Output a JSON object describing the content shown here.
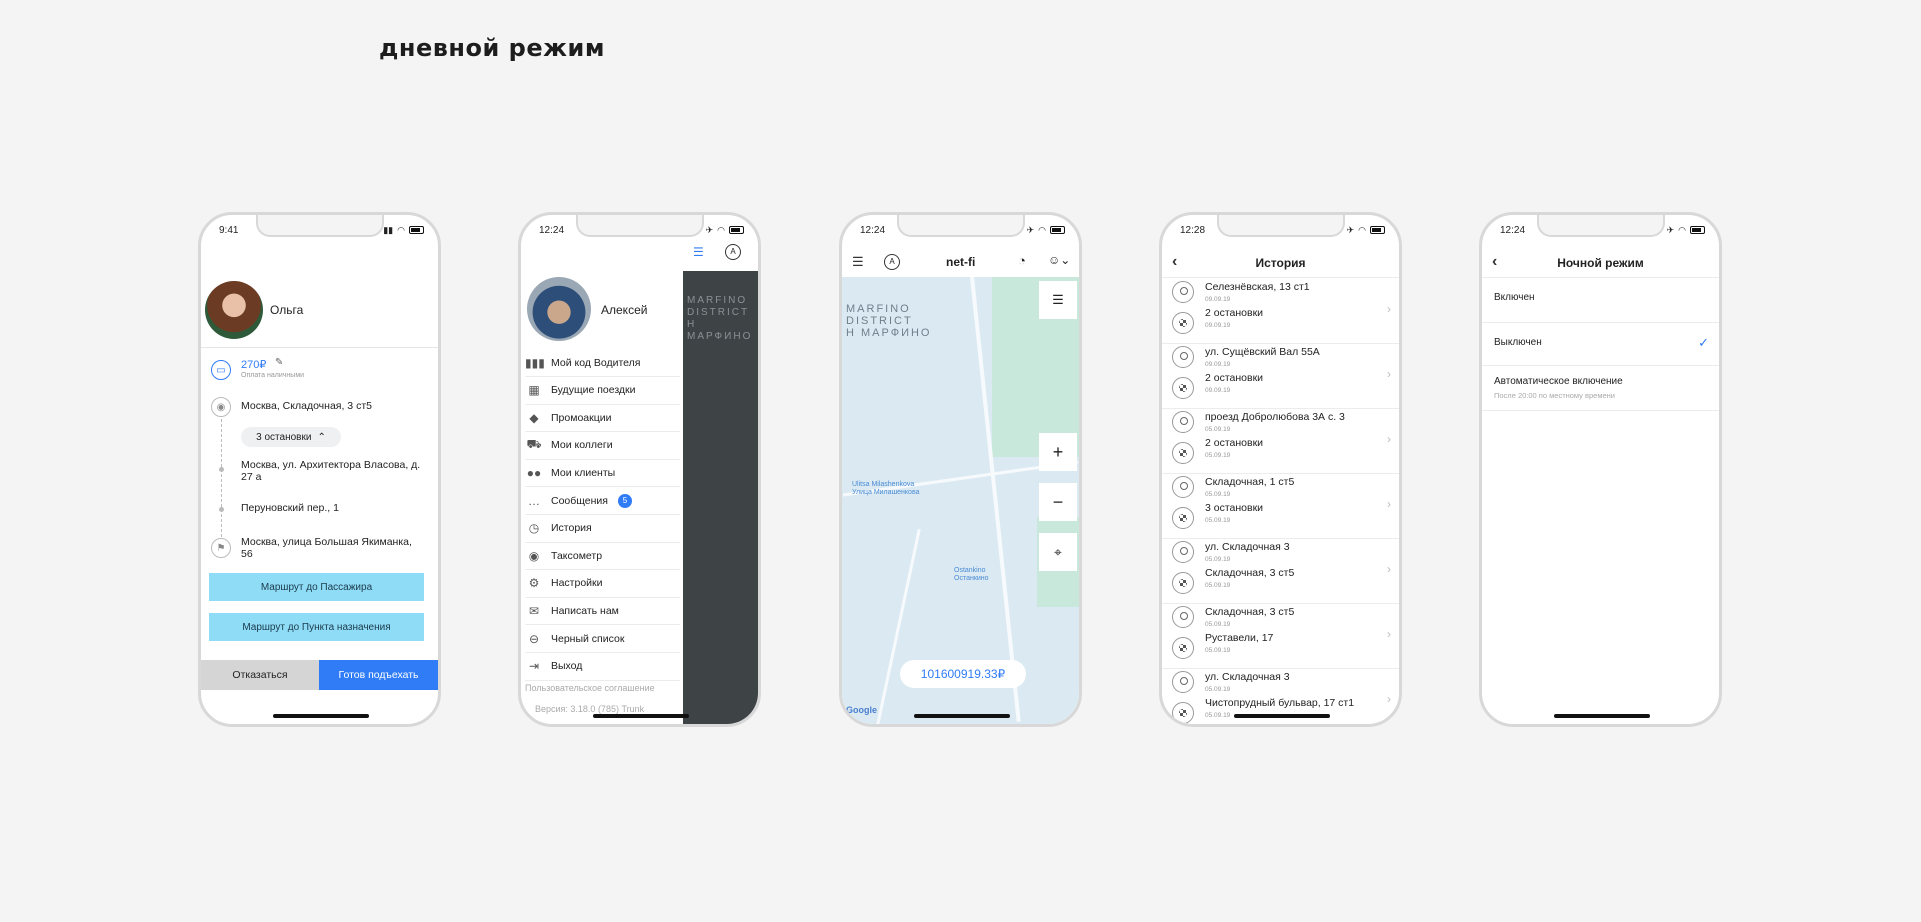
{
  "heading": "дневной режим",
  "phone1": {
    "time": "9:41",
    "name": "Ольга",
    "price": "270₽",
    "payment": "Оплата наличными",
    "from": "Москва, Складочная, 3 ст5",
    "stops_toggle": "3 остановки",
    "stops": [
      "Москва, ул. Архитектора Власова, д. 27 а",
      "Перуновский пер., 1"
    ],
    "to": "Москва, улица Большая Якиманка, 56",
    "route_to_passenger": "Маршрут до Пассажира",
    "route_to_destination": "Маршрут до Пункта назначения",
    "decline": "Отказаться",
    "ready": "Готов подъехать"
  },
  "phone2": {
    "time": "12:24",
    "name": "Алексей",
    "menu": [
      {
        "label": "Мой код Водителя",
        "icon": "barcode-icon",
        "glyph": "▮▮▮"
      },
      {
        "label": "Будущие поездки",
        "icon": "calendar-icon",
        "glyph": "▦"
      },
      {
        "label": "Промоакции",
        "icon": "tag-icon",
        "glyph": "◆"
      },
      {
        "label": "Мои коллеги",
        "icon": "car-icon",
        "glyph": "⛟"
      },
      {
        "label": "Мои клиенты",
        "icon": "users-icon",
        "glyph": "●●"
      },
      {
        "label": "Сообщения",
        "icon": "chat-icon",
        "glyph": "…",
        "badge": "5"
      },
      {
        "label": "История",
        "icon": "clock-icon",
        "glyph": "◷"
      },
      {
        "label": "Таксометр",
        "icon": "eye-icon",
        "glyph": "◉"
      },
      {
        "label": "Настройки",
        "icon": "gear-icon",
        "glyph": "⚙"
      },
      {
        "label": "Написать нам",
        "icon": "mail-icon",
        "glyph": "✉"
      },
      {
        "label": "Черный список",
        "icon": "block-icon",
        "glyph": "⊖"
      },
      {
        "label": "Выход",
        "icon": "exit-icon",
        "glyph": "⇥"
      }
    ],
    "agreement": "Пользовательское соглашение",
    "version": "Версия: 3.18.0 (785) Trunk",
    "map_label": "MARFINO DISTRICT Н МАРФИНО"
  },
  "phone3": {
    "time": "12:24",
    "title": "net-fi",
    "map_district": [
      "MARFINO",
      "DISTRICT",
      "Н МАРФИНО"
    ],
    "street1": "Ulitsa Milashenkova",
    "street1_ru": "Улица Милашенкова",
    "station": "Ostankino",
    "station_ru": "Останкино",
    "balance": "101600919.33₽",
    "google": "Google"
  },
  "phone4": {
    "time": "12:28",
    "title": "История",
    "items": [
      {
        "from": "Селезнёвская, 13 ст1",
        "to": "2 остановки",
        "d1": "09.09.19",
        "d2": "09.09.19"
      },
      {
        "from": "ул. Сущёвский Вал 55А",
        "to": "2 остановки",
        "d1": "09.09.19",
        "d2": "09.09.19"
      },
      {
        "from": "проезд Добролюбова 3А с. 3",
        "to": "2 остановки",
        "d1": "05.09.19",
        "d2": "05.09.19"
      },
      {
        "from": "Складочная, 1 ст5",
        "to": "3 остановки",
        "d1": "05.09.19",
        "d2": "05.09.19"
      },
      {
        "from": "ул. Складочная 3",
        "to": "Складочная, 3 ст5",
        "d1": "05.09.19",
        "d2": "05.09.19"
      },
      {
        "from": "Складочная, 3 ст5",
        "to": "Руставели, 17",
        "d1": "05.09.19",
        "d2": "05.09.19"
      },
      {
        "from": "ул. Складочная 3",
        "to": "Чистопрудный бульвар, 17 ст1",
        "d1": "05.09.19",
        "d2": "05.09.19"
      }
    ]
  },
  "phone5": {
    "time": "12:24",
    "title": "Ночной режим",
    "on": "Включен",
    "off": "Выключен",
    "auto": "Автоматическое включение",
    "auto_hint": "После 20:00 по местному времени"
  },
  "colors": {
    "accent": "#2f7cf6",
    "route_button": "#8fdcf7",
    "map": "#dbeaf2"
  }
}
